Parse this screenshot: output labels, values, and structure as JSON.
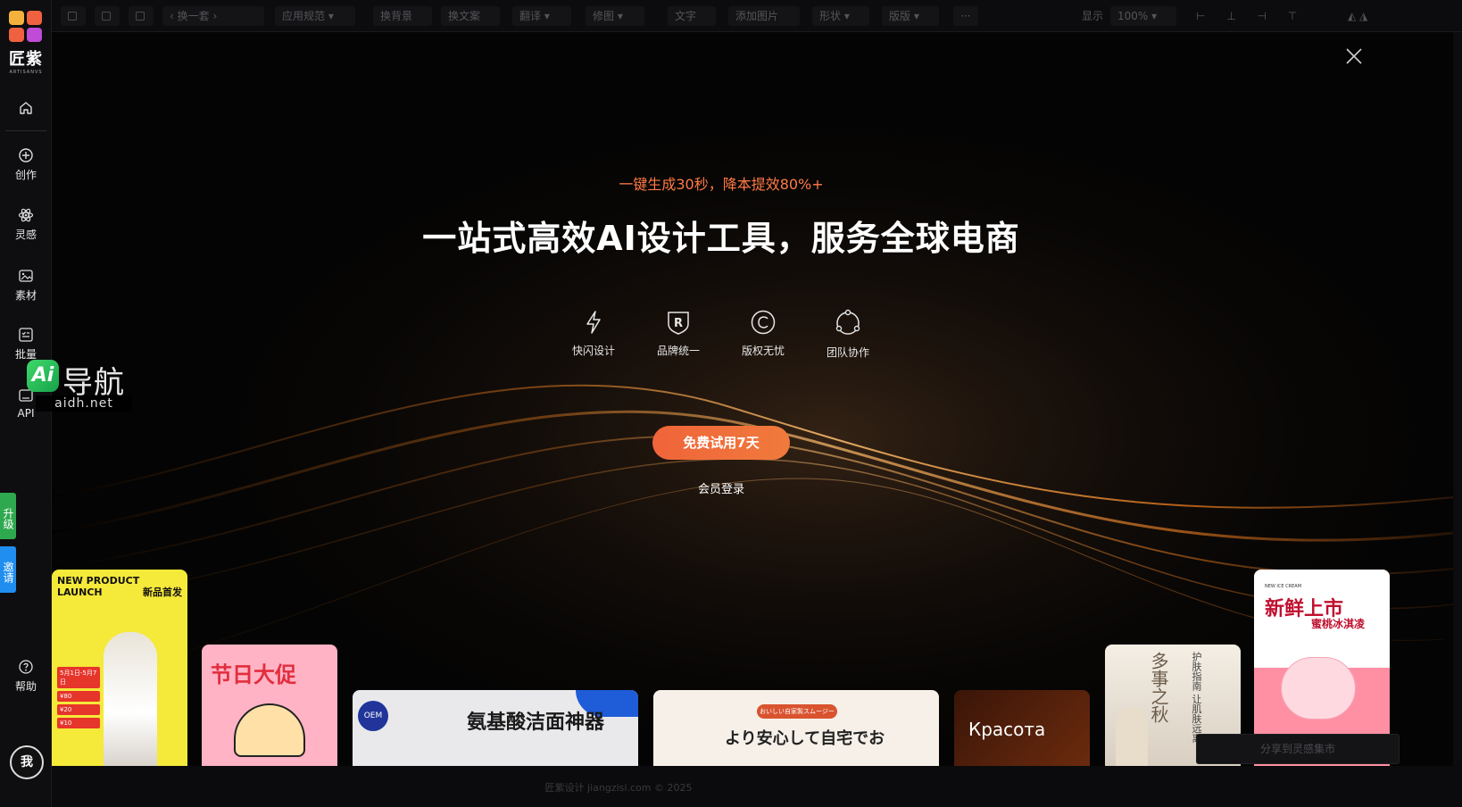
{
  "sidebar": {
    "logo_name": "匠紫",
    "logo_sub": "ARTISANVS",
    "items": [
      {
        "label": ""
      },
      {
        "label": "创作"
      },
      {
        "label": "灵感"
      },
      {
        "label": "素材"
      },
      {
        "label": "批量"
      },
      {
        "label": "API"
      }
    ],
    "upgrade_tag": "升级",
    "invite_tag": "邀请",
    "help_label": "帮助",
    "avatar_text": "我"
  },
  "toolbar": {
    "swap_set": "换一套",
    "app_spec": "应用规范",
    "change_bg": "换背景",
    "change_copy": "换文案",
    "translate": "翻译",
    "retouch": "修图",
    "text": "文字",
    "add_image": "添加图片",
    "shape": "形状",
    "layout": "版版",
    "more": "···",
    "display_label": "显示",
    "zoom": "100%"
  },
  "hero": {
    "promo": "一键生成30秒，降本提效80%+",
    "headline": "一站式高效AI设计工具，服务全球电商",
    "features": [
      {
        "label": "快闪设计",
        "icon": "lightning-icon"
      },
      {
        "label": "品牌统一",
        "icon": "registered-shield-icon"
      },
      {
        "label": "版权无忧",
        "icon": "copyright-icon"
      },
      {
        "label": "团队协作",
        "icon": "team-cycle-icon"
      }
    ],
    "cta": "免费试用7天",
    "login": "会员登录",
    "accent": "#f0643a"
  },
  "cards": {
    "c1_title": "NEW PRODUCT LAUNCH",
    "c1_zh": "新品首发",
    "c1_rows": [
      "¥80",
      "¥20",
      "¥10"
    ],
    "c1_date": "5月1日-5月7日",
    "c2_title": "节日大促",
    "c3_oem": "OEM",
    "c3_title": "氨基酸洁面神器",
    "c4_pill": "おいしい自家製スムージー",
    "c4_title": "より安心して自宅でお",
    "c5_title": "Красота",
    "c6_title": "多事之秋",
    "c6_sub": "护肤指南 让肌肤远离",
    "c7_tag": "NEW ICE CREAM",
    "c7_title": "新鲜上市",
    "c7_sub": "蜜桃冰淇凌"
  },
  "watermark": {
    "badge": "Ai",
    "name": "导航",
    "url": "aidh.net"
  },
  "footer": {
    "copyright": "匠紫设计 jiangzisi.com © 2025",
    "share": "分享到灵感集市"
  }
}
